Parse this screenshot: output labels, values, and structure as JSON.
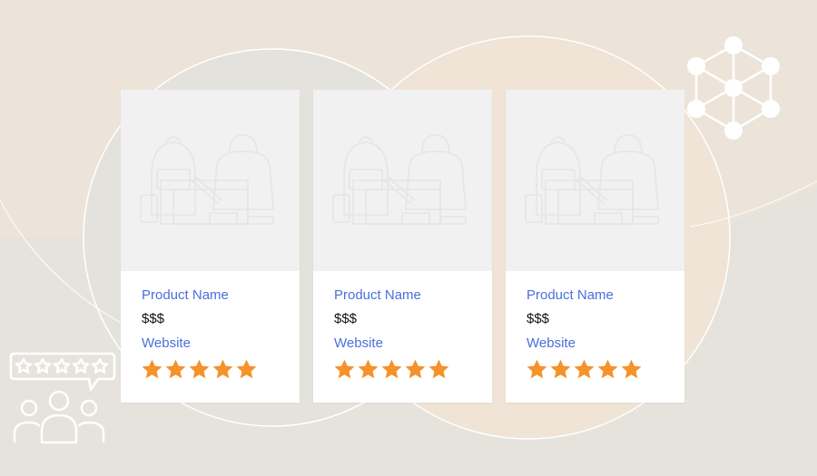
{
  "products": [
    {
      "name": "Product Name",
      "price": "$$$",
      "website_label": "Website",
      "rating": 5,
      "max_rating": 5,
      "image_icon": "bags-placeholder-icon"
    },
    {
      "name": "Product Name",
      "price": "$$$",
      "website_label": "Website",
      "rating": 5,
      "max_rating": 5,
      "image_icon": "bags-placeholder-icon"
    },
    {
      "name": "Product Name",
      "price": "$$$",
      "website_label": "Website",
      "rating": 5,
      "max_rating": 5,
      "image_icon": "bags-placeholder-icon"
    }
  ],
  "decorations": {
    "top_right_icon": "network-hub-icon",
    "bottom_left_icon": "customer-reviews-icon"
  },
  "colors": {
    "background": "#e8e4dc",
    "link": "#4a6fdc",
    "star": "#f5922a",
    "card": "#ffffff",
    "thumbnail": "#f1f1f1"
  }
}
